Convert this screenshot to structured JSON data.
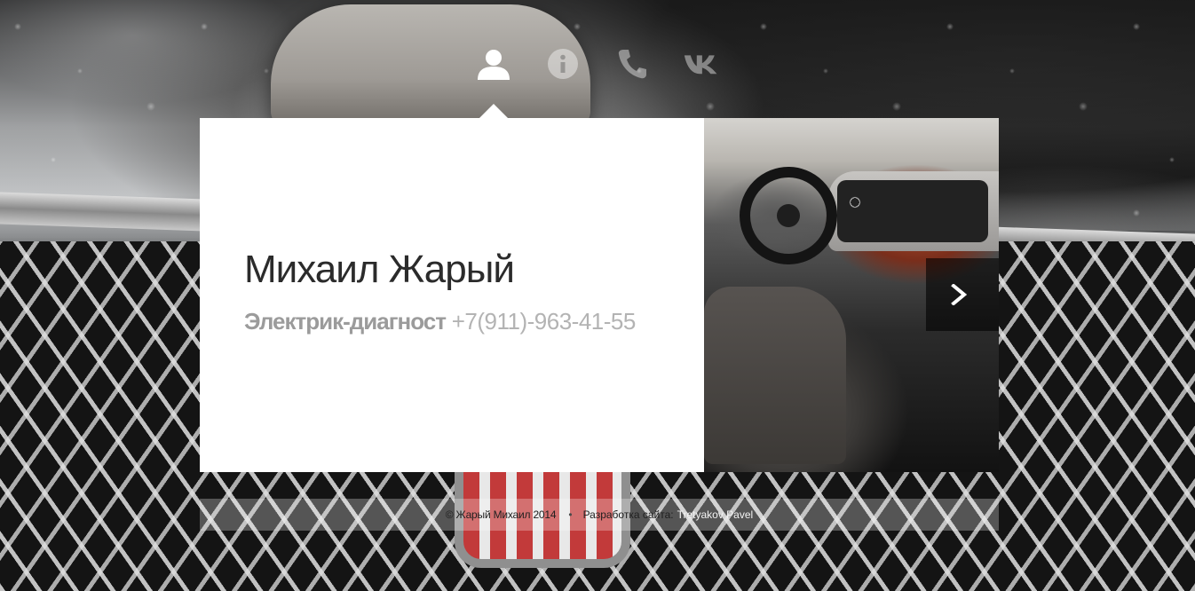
{
  "nav": {
    "items": [
      {
        "icon": "user-icon",
        "active": true
      },
      {
        "icon": "info-icon",
        "active": false
      },
      {
        "icon": "phone-icon",
        "active": false
      },
      {
        "icon": "vk-icon",
        "active": false
      }
    ]
  },
  "card": {
    "name": "Михаил Жарый",
    "role": "Электрик-диагност",
    "phone": "+7(911)-963-41-55"
  },
  "slider": {
    "next_icon": "chevron-right-icon"
  },
  "footer": {
    "copyright": "© Жарый Михаил 2014",
    "separator": "•",
    "credit_label": "Разработка сайта:",
    "credit_name": "Tretyakov Pavel"
  },
  "colors": {
    "card_bg": "#ffffff",
    "name_text": "#2b2b2b",
    "subtitle_text": "#9b9b9b",
    "footer_bg": "rgba(255,255,255,0.28)"
  }
}
